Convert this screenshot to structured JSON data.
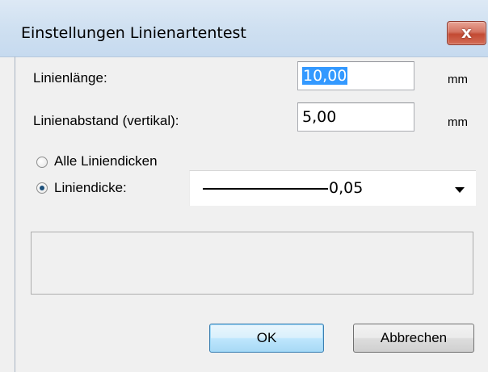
{
  "window": {
    "title": "Einstellungen Linienartentest",
    "close_glyph": "x"
  },
  "fields": {
    "line_length": {
      "label": "Linienlänge:",
      "value": "10,00",
      "unit": "mm"
    },
    "line_spacing": {
      "label": "Linienabstand (vertikal):",
      "value": "5,00",
      "unit": "mm"
    }
  },
  "thickness": {
    "all_label": "Alle Liniendicken",
    "single_label": "Liniendicke:",
    "selected_value": "0,05"
  },
  "buttons": {
    "ok": "OK",
    "cancel": "Abbrechen"
  }
}
